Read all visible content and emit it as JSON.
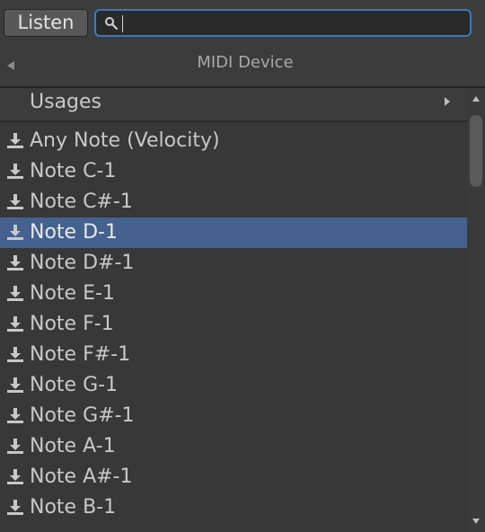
{
  "toolbar": {
    "listen_label": "Listen",
    "search_value": "",
    "search_icon": "search-icon"
  },
  "nav": {
    "title": "MIDI Device",
    "back_icon": "triangle-left-icon"
  },
  "usages": {
    "label": "Usages",
    "arrow_icon": "triangle-right-icon"
  },
  "items": [
    {
      "label": "Any Note (Velocity)",
      "icon": "download-icon",
      "selected": false
    },
    {
      "label": "Note C-1",
      "icon": "download-icon",
      "selected": false
    },
    {
      "label": "Note C#-1",
      "icon": "download-icon",
      "selected": false
    },
    {
      "label": "Note D-1",
      "icon": "download-icon",
      "selected": true
    },
    {
      "label": "Note D#-1",
      "icon": "download-icon",
      "selected": false
    },
    {
      "label": "Note E-1",
      "icon": "download-icon",
      "selected": false
    },
    {
      "label": "Note F-1",
      "icon": "download-icon",
      "selected": false
    },
    {
      "label": "Note F#-1",
      "icon": "download-icon",
      "selected": false
    },
    {
      "label": "Note G-1",
      "icon": "download-icon",
      "selected": false
    },
    {
      "label": "Note G#-1",
      "icon": "download-icon",
      "selected": false
    },
    {
      "label": "Note A-1",
      "icon": "download-icon",
      "selected": false
    },
    {
      "label": "Note A#-1",
      "icon": "download-icon",
      "selected": false
    },
    {
      "label": "Note B-1",
      "icon": "download-icon",
      "selected": false
    }
  ],
  "colors": {
    "background": "#383838",
    "selection": "#44618f",
    "focus_border": "#3a79bb"
  }
}
